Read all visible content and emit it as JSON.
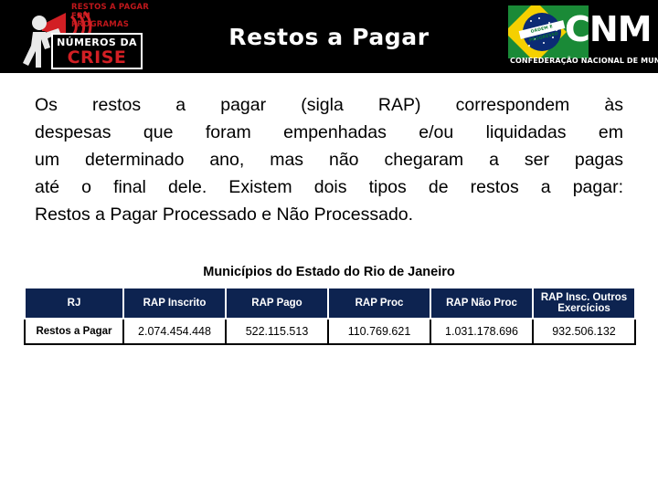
{
  "header": {
    "title": "Restos a Pagar",
    "left_logo": {
      "name": "numeros-da-crise-logo",
      "top_line_1": "RESTOS A PAGAR",
      "top_line_2": "FPM",
      "top_line_3": "PROGRAMAS",
      "box_line_1": "NÚMEROS DA",
      "box_line_2": "CRISE"
    },
    "right_logo": {
      "name": "cnm-logo",
      "acronym": "CNM",
      "subtitle": "CONFEDERAÇÃO NACIONAL DE MUNICÍPIOS",
      "flag_motto": "ORDEM E PROGRESSO"
    }
  },
  "body": {
    "line1": "Os restos a pagar (sigla RAP) correspondem às",
    "line2": "despesas que foram empenhadas e/ou liquidadas em",
    "line3": "um determinado ano, mas não chegaram a ser pagas",
    "line4": "até o final dele. Existem dois tipos de restos a pagar:",
    "line5": "Restos a Pagar Processado e Não Processado."
  },
  "table": {
    "caption": "Municípios do Estado do Rio de Janeiro",
    "headers": [
      "RJ",
      "RAP Inscrito",
      "RAP Pago",
      "RAP Proc",
      "RAP Não Proc",
      "RAP Insc. Outros Exercícios"
    ],
    "rows": [
      {
        "label": "Restos a Pagar",
        "rap_inscrito": "2.074.454.448",
        "rap_pago": "522.115.513",
        "rap_proc": "110.769.621",
        "rap_nao_proc": "1.031.178.696",
        "rap_insc_outros": "932.506.132"
      }
    ]
  },
  "colors": {
    "header_band": "#000000",
    "table_header": "#0d2350",
    "accent_red": "#c0171b",
    "flag_green": "#1a8a37",
    "flag_yellow": "#f5d000",
    "flag_blue": "#0b2b74"
  }
}
